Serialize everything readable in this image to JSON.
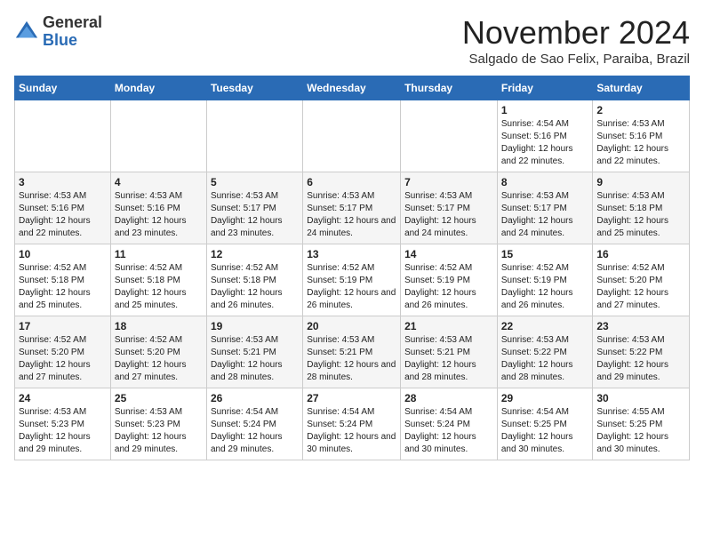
{
  "logo": {
    "general": "General",
    "blue": "Blue"
  },
  "header": {
    "month": "November 2024",
    "location": "Salgado de Sao Felix, Paraiba, Brazil"
  },
  "weekdays": [
    "Sunday",
    "Monday",
    "Tuesday",
    "Wednesday",
    "Thursday",
    "Friday",
    "Saturday"
  ],
  "weeks": [
    [
      {
        "day": "",
        "detail": ""
      },
      {
        "day": "",
        "detail": ""
      },
      {
        "day": "",
        "detail": ""
      },
      {
        "day": "",
        "detail": ""
      },
      {
        "day": "",
        "detail": ""
      },
      {
        "day": "1",
        "detail": "Sunrise: 4:54 AM\nSunset: 5:16 PM\nDaylight: 12 hours and 22 minutes."
      },
      {
        "day": "2",
        "detail": "Sunrise: 4:53 AM\nSunset: 5:16 PM\nDaylight: 12 hours and 22 minutes."
      }
    ],
    [
      {
        "day": "3",
        "detail": "Sunrise: 4:53 AM\nSunset: 5:16 PM\nDaylight: 12 hours and 22 minutes."
      },
      {
        "day": "4",
        "detail": "Sunrise: 4:53 AM\nSunset: 5:16 PM\nDaylight: 12 hours and 23 minutes."
      },
      {
        "day": "5",
        "detail": "Sunrise: 4:53 AM\nSunset: 5:17 PM\nDaylight: 12 hours and 23 minutes."
      },
      {
        "day": "6",
        "detail": "Sunrise: 4:53 AM\nSunset: 5:17 PM\nDaylight: 12 hours and 24 minutes."
      },
      {
        "day": "7",
        "detail": "Sunrise: 4:53 AM\nSunset: 5:17 PM\nDaylight: 12 hours and 24 minutes."
      },
      {
        "day": "8",
        "detail": "Sunrise: 4:53 AM\nSunset: 5:17 PM\nDaylight: 12 hours and 24 minutes."
      },
      {
        "day": "9",
        "detail": "Sunrise: 4:53 AM\nSunset: 5:18 PM\nDaylight: 12 hours and 25 minutes."
      }
    ],
    [
      {
        "day": "10",
        "detail": "Sunrise: 4:52 AM\nSunset: 5:18 PM\nDaylight: 12 hours and 25 minutes."
      },
      {
        "day": "11",
        "detail": "Sunrise: 4:52 AM\nSunset: 5:18 PM\nDaylight: 12 hours and 25 minutes."
      },
      {
        "day": "12",
        "detail": "Sunrise: 4:52 AM\nSunset: 5:18 PM\nDaylight: 12 hours and 26 minutes."
      },
      {
        "day": "13",
        "detail": "Sunrise: 4:52 AM\nSunset: 5:19 PM\nDaylight: 12 hours and 26 minutes."
      },
      {
        "day": "14",
        "detail": "Sunrise: 4:52 AM\nSunset: 5:19 PM\nDaylight: 12 hours and 26 minutes."
      },
      {
        "day": "15",
        "detail": "Sunrise: 4:52 AM\nSunset: 5:19 PM\nDaylight: 12 hours and 26 minutes."
      },
      {
        "day": "16",
        "detail": "Sunrise: 4:52 AM\nSunset: 5:20 PM\nDaylight: 12 hours and 27 minutes."
      }
    ],
    [
      {
        "day": "17",
        "detail": "Sunrise: 4:52 AM\nSunset: 5:20 PM\nDaylight: 12 hours and 27 minutes."
      },
      {
        "day": "18",
        "detail": "Sunrise: 4:52 AM\nSunset: 5:20 PM\nDaylight: 12 hours and 27 minutes."
      },
      {
        "day": "19",
        "detail": "Sunrise: 4:53 AM\nSunset: 5:21 PM\nDaylight: 12 hours and 28 minutes."
      },
      {
        "day": "20",
        "detail": "Sunrise: 4:53 AM\nSunset: 5:21 PM\nDaylight: 12 hours and 28 minutes."
      },
      {
        "day": "21",
        "detail": "Sunrise: 4:53 AM\nSunset: 5:21 PM\nDaylight: 12 hours and 28 minutes."
      },
      {
        "day": "22",
        "detail": "Sunrise: 4:53 AM\nSunset: 5:22 PM\nDaylight: 12 hours and 28 minutes."
      },
      {
        "day": "23",
        "detail": "Sunrise: 4:53 AM\nSunset: 5:22 PM\nDaylight: 12 hours and 29 minutes."
      }
    ],
    [
      {
        "day": "24",
        "detail": "Sunrise: 4:53 AM\nSunset: 5:23 PM\nDaylight: 12 hours and 29 minutes."
      },
      {
        "day": "25",
        "detail": "Sunrise: 4:53 AM\nSunset: 5:23 PM\nDaylight: 12 hours and 29 minutes."
      },
      {
        "day": "26",
        "detail": "Sunrise: 4:54 AM\nSunset: 5:24 PM\nDaylight: 12 hours and 29 minutes."
      },
      {
        "day": "27",
        "detail": "Sunrise: 4:54 AM\nSunset: 5:24 PM\nDaylight: 12 hours and 30 minutes."
      },
      {
        "day": "28",
        "detail": "Sunrise: 4:54 AM\nSunset: 5:24 PM\nDaylight: 12 hours and 30 minutes."
      },
      {
        "day": "29",
        "detail": "Sunrise: 4:54 AM\nSunset: 5:25 PM\nDaylight: 12 hours and 30 minutes."
      },
      {
        "day": "30",
        "detail": "Sunrise: 4:55 AM\nSunset: 5:25 PM\nDaylight: 12 hours and 30 minutes."
      }
    ]
  ]
}
